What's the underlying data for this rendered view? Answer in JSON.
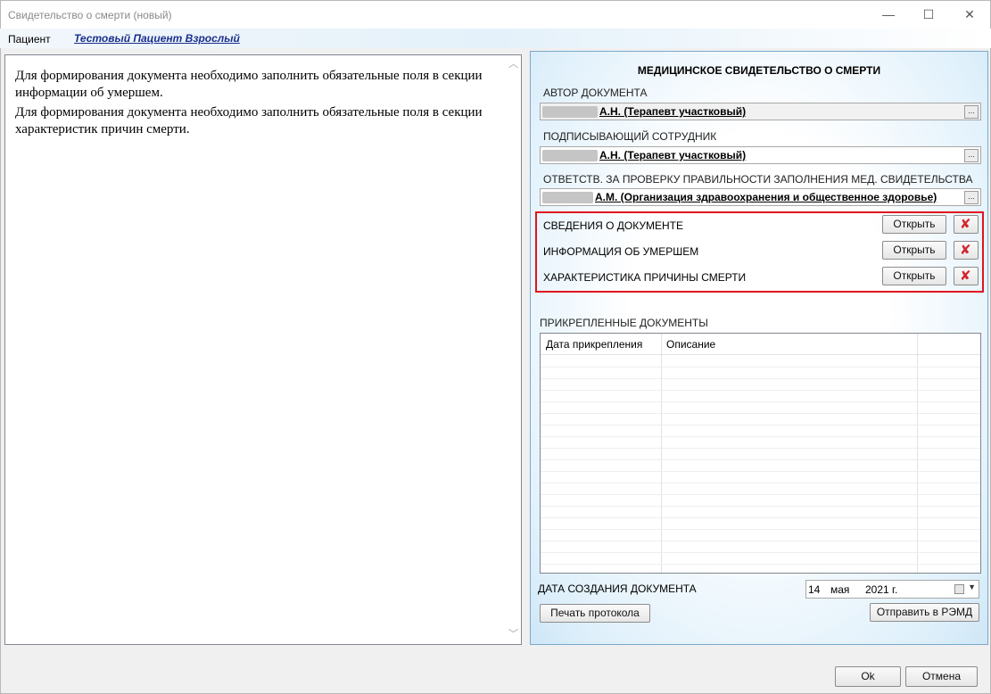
{
  "window": {
    "title": "Свидетельство о смерти (новый)",
    "minimize_glyph": "—",
    "maximize_glyph": "☐",
    "close_glyph": "✕"
  },
  "patient": {
    "label": "Пациент",
    "name": "Тестовый Пациент Взрослый"
  },
  "messages": [
    "Для формирования документа необходимо заполнить обязательные поля в секции информации об умершем.",
    "Для формирования документа необходимо заполнить обязательные поля в секции характеристик причин смерти."
  ],
  "document": {
    "heading": "МЕДИЦИНСКОЕ СВИДЕТЕЛЬСТВО О СМЕРТИ",
    "author": {
      "label": "АВТОР ДОКУМЕНТА",
      "value": "А.Н. (Терапевт участковый)"
    },
    "signer": {
      "label": "ПОДПИСЫВАЮЩИЙ СОТРУДНИК",
      "value": "А.Н. (Терапевт участковый)"
    },
    "reviewer": {
      "label": "ОТВЕТСТВ. ЗА ПРОВЕРКУ ПРАВИЛЬНОСТИ ЗАПОЛНЕНИЯ МЕД. СВИДЕТЕЛЬСТВА",
      "value": "А.М. (Организация здравоохранения и общественное здоровье)"
    },
    "browse_label": "...",
    "sections": [
      {
        "label": "СВЕДЕНИЯ О ДОКУМЕНТЕ",
        "open_label": "Открыть"
      },
      {
        "label": "ИНФОРМАЦИЯ ОБ УМЕРШЕМ",
        "open_label": "Открыть"
      },
      {
        "label": "ХАРАКТЕРИСТИКА ПРИЧИНЫ СМЕРТИ",
        "open_label": "Открыть"
      }
    ],
    "attached": {
      "label": "ПРИКРЕПЛЕННЫЕ ДОКУМЕНТЫ",
      "columns": [
        "Дата прикрепления",
        "Описание"
      ]
    },
    "creation_date": {
      "label": "ДАТА СОЗДАНИЯ ДОКУМЕНТА",
      "day": "14",
      "month": "мая",
      "year": "2021 г."
    },
    "print_label": "Печать протокола",
    "send_label": "Отправить в РЭМД"
  },
  "footer": {
    "ok_label": "Ok",
    "cancel_label": "Отмена"
  },
  "colors": {
    "accent_link": "#1a2f8c",
    "highlight_border": "#e0141e",
    "delete_icon": "#d2262c"
  }
}
